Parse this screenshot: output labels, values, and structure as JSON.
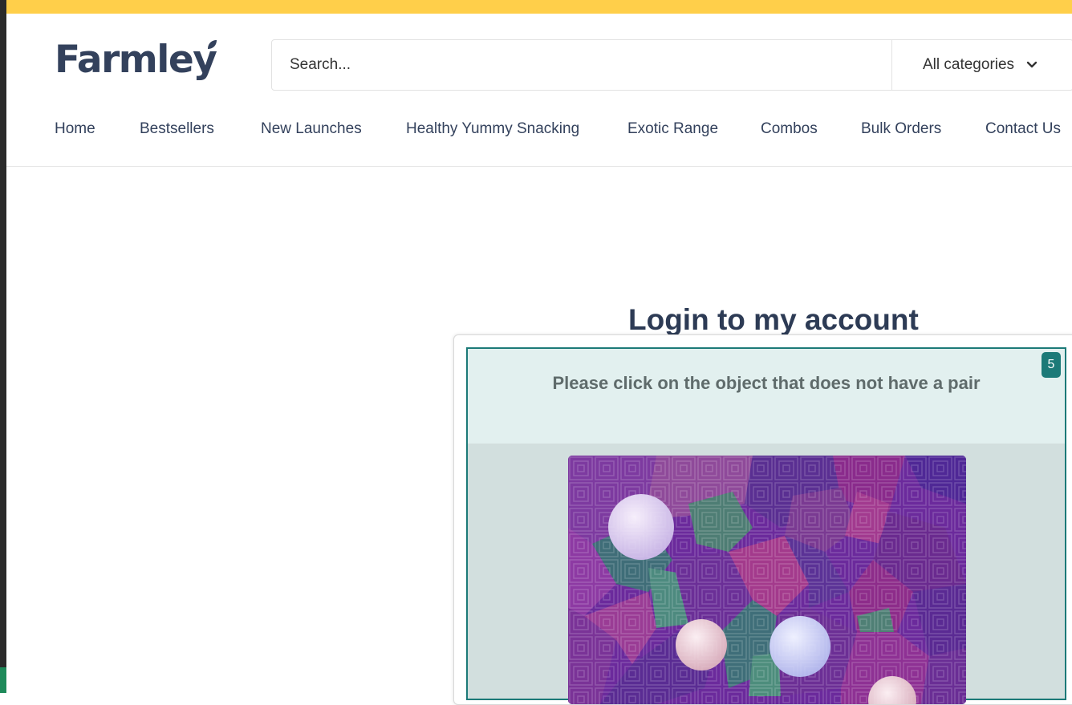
{
  "brand": {
    "logo_text": "Farmley",
    "accent": "#ffcf4a",
    "text_color": "#33415c"
  },
  "search": {
    "placeholder": "Search...",
    "category_label": "All categories"
  },
  "nav": {
    "home": "Home",
    "bestsellers": "Bestsellers",
    "new_launches": "New Launches",
    "healthy": "Healthy Yummy Snacking",
    "exotic": "Exotic Range",
    "combos": "Combos",
    "bulk": "Bulk Orders",
    "contact": "Contact Us"
  },
  "login": {
    "title": "Login to my account"
  },
  "captcha": {
    "prompt": "Please click on the object that does not have a pair",
    "badge": "5",
    "frame_color": "#1c7a78",
    "image_icon": "puzzle-image"
  }
}
